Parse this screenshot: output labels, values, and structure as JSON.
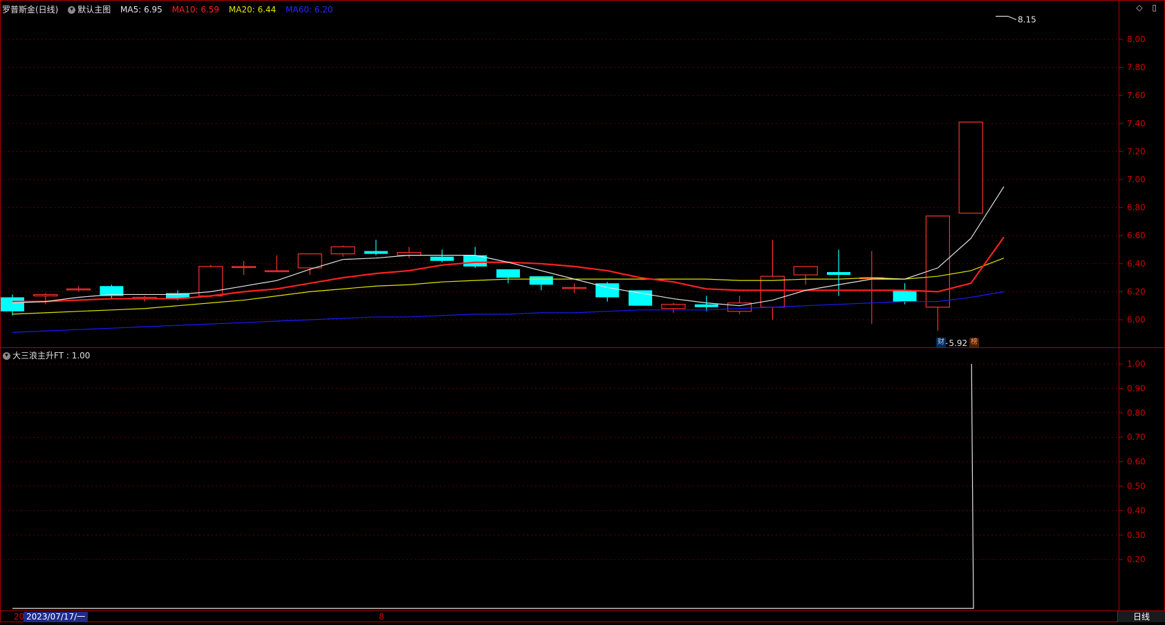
{
  "header": {
    "stock_title": "罗普斯金(日线)",
    "template_name": "默认主图",
    "ma": [
      {
        "label": "MA5: 6.95",
        "color": "#e6e6e6"
      },
      {
        "label": "MA10: 6.59",
        "color": "#ff2020"
      },
      {
        "label": "MA20: 6.44",
        "color": "#e6e600"
      },
      {
        "label": "MA60: 6.20",
        "color": "#2a2aff"
      }
    ]
  },
  "indicator_header": {
    "label": "大三浪主升FT : 1.00"
  },
  "bottom_bar": {
    "date_prefix": "20",
    "date_label": "2023/07/17/一",
    "x_tick": "8",
    "period_tab": "日线"
  },
  "markers": {
    "finance": "财",
    "rank": "榜"
  },
  "colors": {
    "up": "#ff3030",
    "down": "#00ffff",
    "ma5": "#e6e6e6",
    "ma10": "#ff2020",
    "ma20": "#e6e600",
    "ma60": "#1a1aff",
    "grid": "#6b0000",
    "axis": "#b00000",
    "label": "#d00000"
  },
  "chart_data": [
    {
      "type": "candlestick",
      "title": "罗普斯金(日线)",
      "y_ticks": [
        8.0,
        7.8,
        7.6,
        7.4,
        7.2,
        7.0,
        6.8,
        6.6,
        6.4,
        6.2,
        6.0
      ],
      "ylim": [
        5.8,
        8.2
      ],
      "annotations": {
        "high_label": "8.15",
        "low_label": "5.92",
        "high_value": 8.15,
        "low_value": 5.92
      },
      "candles": [
        {
          "o": 6.16,
          "h": 6.18,
          "l": 6.03,
          "c": 6.06
        },
        {
          "o": 6.17,
          "h": 6.19,
          "l": 6.11,
          "c": 6.18
        },
        {
          "o": 6.22,
          "h": 6.24,
          "l": 6.2,
          "c": 6.22
        },
        {
          "o": 6.24,
          "h": 6.25,
          "l": 6.15,
          "c": 6.17
        },
        {
          "o": 6.15,
          "h": 6.17,
          "l": 6.13,
          "c": 6.16
        },
        {
          "o": 6.19,
          "h": 6.21,
          "l": 6.14,
          "c": 6.15
        },
        {
          "o": 6.17,
          "h": 6.39,
          "l": 6.16,
          "c": 6.38
        },
        {
          "o": 6.38,
          "h": 6.42,
          "l": 6.32,
          "c": 6.38
        },
        {
          "o": 6.35,
          "h": 6.46,
          "l": 6.34,
          "c": 6.35
        },
        {
          "o": 6.37,
          "h": 6.47,
          "l": 6.32,
          "c": 6.47
        },
        {
          "o": 6.47,
          "h": 6.53,
          "l": 6.45,
          "c": 6.52
        },
        {
          "o": 6.49,
          "h": 6.57,
          "l": 6.46,
          "c": 6.47
        },
        {
          "o": 6.46,
          "h": 6.52,
          "l": 6.44,
          "c": 6.48
        },
        {
          "o": 6.45,
          "h": 6.5,
          "l": 6.41,
          "c": 6.42
        },
        {
          "o": 6.46,
          "h": 6.52,
          "l": 6.37,
          "c": 6.38
        },
        {
          "o": 6.36,
          "h": 6.36,
          "l": 6.26,
          "c": 6.3
        },
        {
          "o": 6.31,
          "h": 6.31,
          "l": 6.21,
          "c": 6.25
        },
        {
          "o": 6.23,
          "h": 6.26,
          "l": 6.19,
          "c": 6.23
        },
        {
          "o": 6.26,
          "h": 6.27,
          "l": 6.13,
          "c": 6.16
        },
        {
          "o": 6.21,
          "h": 6.21,
          "l": 6.1,
          "c": 6.1
        },
        {
          "o": 6.08,
          "h": 6.12,
          "l": 6.05,
          "c": 6.11
        },
        {
          "o": 6.11,
          "h": 6.17,
          "l": 6.06,
          "c": 6.09
        },
        {
          "o": 6.06,
          "h": 6.17,
          "l": 6.04,
          "c": 6.12
        },
        {
          "o": 6.09,
          "h": 6.57,
          "l": 6.0,
          "c": 6.31
        },
        {
          "o": 6.32,
          "h": 6.38,
          "l": 6.25,
          "c": 6.38
        },
        {
          "o": 6.34,
          "h": 6.5,
          "l": 6.17,
          "c": 6.32
        },
        {
          "o": 6.3,
          "h": 6.49,
          "l": 5.97,
          "c": 6.3
        },
        {
          "o": 6.21,
          "h": 6.26,
          "l": 6.11,
          "c": 6.13
        },
        {
          "o": 6.09,
          "h": 6.74,
          "l": 5.92,
          "c": 6.74
        },
        {
          "o": 6.76,
          "h": 7.41,
          "l": 6.76,
          "c": 7.41
        }
      ],
      "ma5": [
        6.12,
        6.13,
        6.16,
        6.18,
        6.18,
        6.18,
        6.2,
        6.24,
        6.28,
        6.36,
        6.43,
        6.44,
        6.46,
        6.46,
        6.46,
        6.41,
        6.35,
        6.29,
        6.23,
        6.19,
        6.15,
        6.12,
        6.1,
        6.14,
        6.21,
        6.25,
        6.29,
        6.29,
        6.37,
        6.58,
        6.95
      ],
      "ma10": [
        6.13,
        6.13,
        6.14,
        6.15,
        6.15,
        6.15,
        6.17,
        6.2,
        6.22,
        6.26,
        6.3,
        6.33,
        6.35,
        6.39,
        6.41,
        6.41,
        6.4,
        6.38,
        6.35,
        6.3,
        6.27,
        6.22,
        6.21,
        6.21,
        6.21,
        6.21,
        6.21,
        6.21,
        6.2,
        6.26,
        6.59
      ],
      "ma20": [
        6.04,
        6.05,
        6.06,
        6.07,
        6.08,
        6.1,
        6.12,
        6.14,
        6.17,
        6.2,
        6.22,
        6.24,
        6.25,
        6.27,
        6.28,
        6.29,
        6.29,
        6.29,
        6.29,
        6.29,
        6.29,
        6.29,
        6.28,
        6.28,
        6.29,
        6.29,
        6.3,
        6.29,
        6.31,
        6.35,
        6.44
      ],
      "ma60": [
        5.91,
        5.92,
        5.93,
        5.94,
        5.95,
        5.96,
        5.97,
        5.98,
        5.99,
        6.0,
        6.01,
        6.02,
        6.02,
        6.03,
        6.04,
        6.04,
        6.05,
        6.05,
        6.06,
        6.07,
        6.07,
        6.07,
        6.08,
        6.09,
        6.1,
        6.11,
        6.12,
        6.13,
        6.13,
        6.16,
        6.2
      ]
    },
    {
      "type": "line",
      "title": "大三浪主升FT",
      "y_ticks": [
        1.0,
        0.9,
        0.8,
        0.7,
        0.6,
        0.5,
        0.4,
        0.3,
        0.2
      ],
      "ylim": [
        0.0,
        1.0
      ],
      "series": [
        {
          "name": "大三浪主升FT",
          "values": [
            0,
            0,
            0,
            0,
            0,
            0,
            0,
            0,
            0,
            0,
            0,
            0,
            0,
            0,
            0,
            0,
            0,
            0,
            0,
            0,
            0,
            0,
            0,
            0,
            0,
            0,
            0,
            0,
            0,
            0,
            1.0
          ]
        }
      ]
    }
  ]
}
